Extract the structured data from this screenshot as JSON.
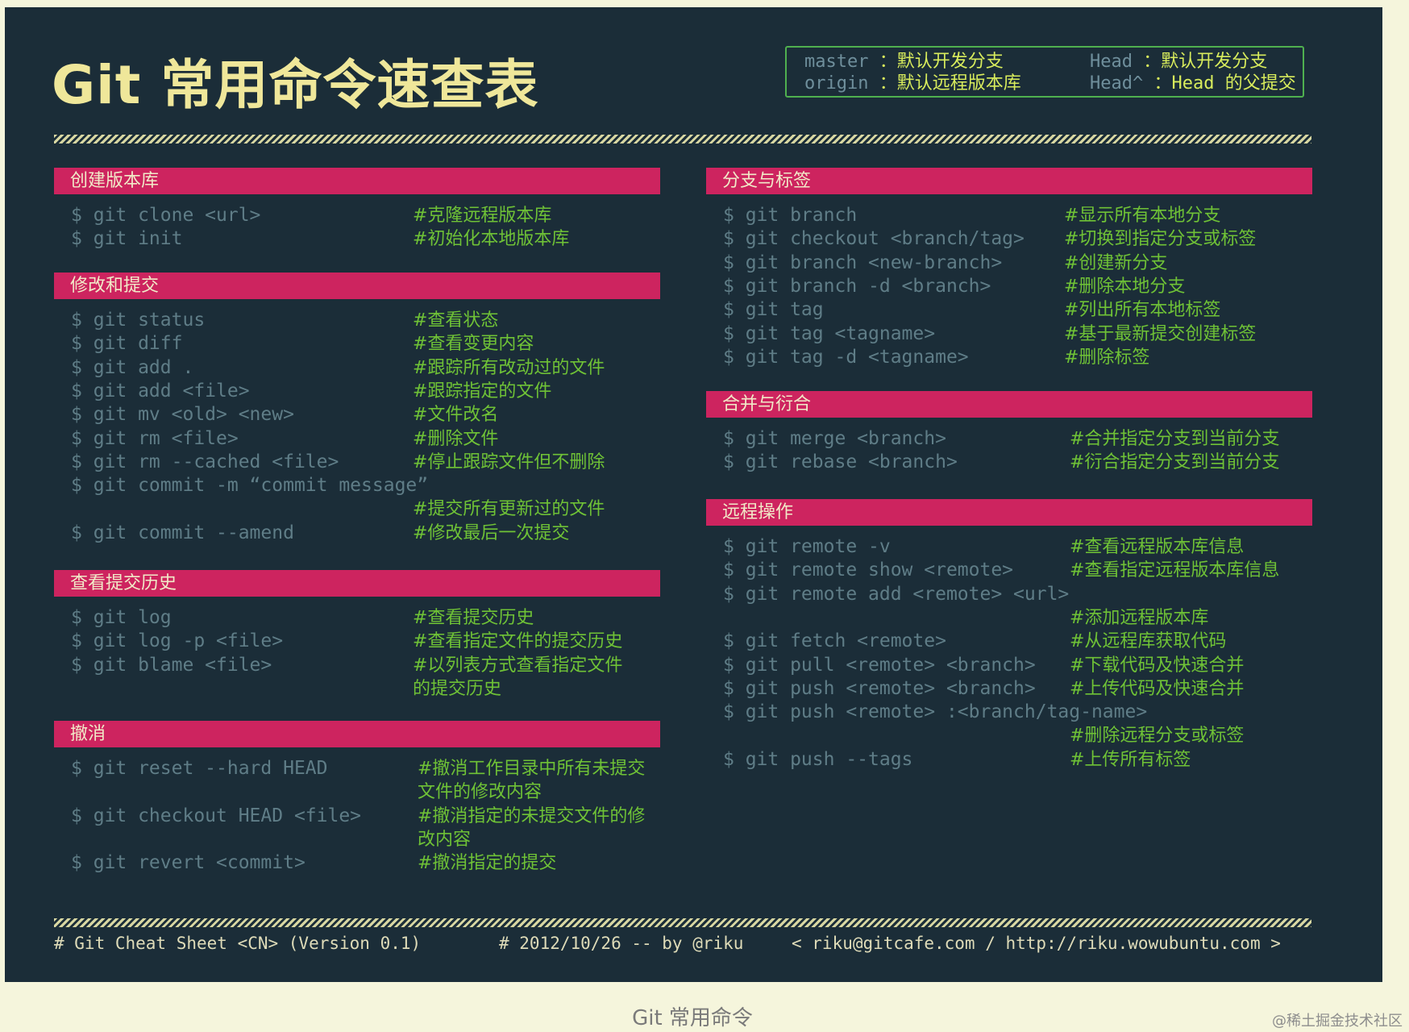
{
  "title": "Git 常用命令速查表",
  "legend": [
    {
      "key": "master",
      "value": "：默认开发分支"
    },
    {
      "key": "Head",
      "value": "：默认开发分支"
    },
    {
      "key": "origin",
      "value": "：默认远程版本库"
    },
    {
      "key": "Head^",
      "value": "：Head 的父提交"
    }
  ],
  "left_sections": [
    {
      "title": "创建版本库",
      "rows": [
        {
          "cmd": "$ git clone <url>",
          "comment": [
            "#克隆远程版本库"
          ]
        },
        {
          "cmd": "$ git init",
          "comment": [
            "#初始化本地版本库"
          ]
        }
      ]
    },
    {
      "title": "修改和提交",
      "rows": [
        {
          "cmd": "$ git status",
          "comment": [
            "#查看状态"
          ]
        },
        {
          "cmd": "$ git diff",
          "comment": [
            "#查看变更内容"
          ]
        },
        {
          "cmd": "$ git add .",
          "comment": [
            "#跟踪所有改动过的文件"
          ]
        },
        {
          "cmd": "$ git add <file>",
          "comment": [
            "#跟踪指定的文件"
          ]
        },
        {
          "cmd": "$ git mv <old> <new>",
          "comment": [
            "#文件改名"
          ]
        },
        {
          "cmd": "$ git rm <file>",
          "comment": [
            "#删除文件"
          ]
        },
        {
          "cmd": "$ git rm --cached <file>",
          "comment": [
            "#停止跟踪文件但不删除"
          ]
        },
        {
          "cmd": "$ git commit -m “commit message”",
          "comment": [
            "",
            "#提交所有更新过的文件"
          ]
        },
        {
          "cmd": "$ git commit --amend",
          "comment": [
            "#修改最后一次提交"
          ]
        }
      ]
    },
    {
      "title": "查看提交历史",
      "rows": [
        {
          "cmd": "$ git log",
          "comment": [
            "#查看提交历史"
          ]
        },
        {
          "cmd": "$ git log -p <file>",
          "comment": [
            "#查看指定文件的提交历史"
          ]
        },
        {
          "cmd": "$ git blame <file>",
          "comment": [
            "#以列表方式查看指定文件",
            "的提交历史"
          ]
        }
      ]
    },
    {
      "title": "撤消",
      "rows": [
        {
          "cmd": "$ git reset --hard HEAD",
          "comment": [
            "#撤消工作目录中所有未提交",
            "文件的修改内容"
          ]
        },
        {
          "cmd": "$ git checkout HEAD <file>",
          "comment": [
            "#撤消指定的未提交文件的修",
            "改内容"
          ]
        },
        {
          "cmd": "$ git revert <commit>",
          "comment": [
            "#撤消指定的提交"
          ]
        }
      ]
    }
  ],
  "right_sections": [
    {
      "title": "分支与标签",
      "rows": [
        {
          "cmd": "$ git branch",
          "comment": [
            "#显示所有本地分支"
          ]
        },
        {
          "cmd": "$ git checkout <branch/tag>",
          "comment": [
            "#切换到指定分支或标签"
          ]
        },
        {
          "cmd": "$ git branch <new-branch>",
          "comment": [
            "#创建新分支"
          ]
        },
        {
          "cmd": "$ git branch -d <branch>",
          "comment": [
            "#删除本地分支"
          ]
        },
        {
          "cmd": "$ git tag",
          "comment": [
            "#列出所有本地标签"
          ]
        },
        {
          "cmd": "$ git tag <tagname>",
          "comment": [
            "#基于最新提交创建标签"
          ]
        },
        {
          "cmd": "$ git tag -d <tagname>",
          "comment": [
            "#删除标签"
          ]
        }
      ]
    },
    {
      "title": "合并与衍合",
      "rows": [
        {
          "cmd": "$ git merge <branch>",
          "comment": [
            "#合并指定分支到当前分支"
          ]
        },
        {
          "cmd": "$ git rebase <branch>",
          "comment": [
            "#衍合指定分支到当前分支"
          ]
        }
      ]
    },
    {
      "title": "远程操作",
      "rows": [
        {
          "cmd": "$ git remote -v",
          "comment": [
            "#查看远程版本库信息"
          ]
        },
        {
          "cmd": "$ git remote show <remote>",
          "comment": [
            "#查看指定远程版本库信息"
          ]
        },
        {
          "cmd": "$ git remote add <remote> <url>",
          "comment": [
            "",
            "#添加远程版本库"
          ]
        },
        {
          "cmd": "$ git fetch <remote>",
          "comment": [
            "#从远程库获取代码"
          ]
        },
        {
          "cmd": "$ git pull <remote> <branch>",
          "comment": [
            "#下载代码及快速合并"
          ]
        },
        {
          "cmd": "$ git push <remote> <branch>",
          "comment": [
            "#上传代码及快速合并"
          ]
        },
        {
          "cmd": "$ git push <remote> :<branch/tag-name>",
          "comment": [
            "",
            "#删除远程分支或标签"
          ]
        },
        {
          "cmd": "$ git push --tags",
          "comment": [
            "#上传所有标签"
          ]
        }
      ]
    }
  ],
  "footer": {
    "left": "# Git Cheat Sheet <CN> (Version 0.1)",
    "middle": "# 2012/10/26  -- by @riku",
    "right": "< riku@gitcafe.com / http://riku.wowubuntu.com >"
  },
  "caption": "Git 常用命令",
  "watermark": "@稀土掘金技术社区"
}
